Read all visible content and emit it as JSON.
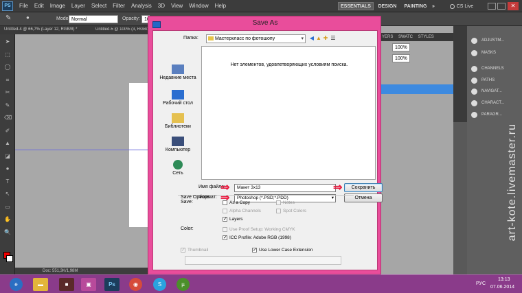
{
  "photoshop": {
    "logo": "PS",
    "menu": [
      "File",
      "Edit",
      "Image",
      "Layer",
      "Select",
      "Filter",
      "Analysis",
      "3D",
      "View",
      "Window",
      "Help"
    ],
    "workspaces": [
      "ESSENTIALS",
      "DESIGN",
      "PAINTING",
      "»"
    ],
    "cslive": "CS Live",
    "options": {
      "mode_label": "Mode:",
      "mode_value": "Normal",
      "opacity_label": "Opacity:",
      "opacity_value": "100%",
      "opacity_right": "100%",
      "fill_right": "100%"
    },
    "tabs": [
      "Untitled-4 @ 66,7% (Layer 12, RGB/8) *",
      "Untitled-5 @ 100% (3, RGB/8)*"
    ],
    "layer_panel_tabs": [
      "YERS",
      "SWATC",
      "STYLES"
    ],
    "status": "Doc: 551,3K/1,98M",
    "panels": [
      "ADJUSTM...",
      "MASKS",
      "CHANNELS",
      "PATHS",
      "NAVIGAT...",
      "CHARACT...",
      "PARAGR..."
    ]
  },
  "dialog": {
    "title": "Save As",
    "folder_label": "Папка:",
    "folder_value": "Мастеркласс по фотошопу",
    "empty_message": "Нет элементов, удовлетворяющих условиям поиска.",
    "places": [
      "Недавние места",
      "Рабочий стол",
      "Библиотеки",
      "Компьютер",
      "Сеть"
    ],
    "filename_label": "Имя файла:",
    "filename_value": "Макет 3x13",
    "format_label": "Формат:",
    "format_value": "Photoshop (*.PSD;*.PDD)",
    "save_button": "Сохранить",
    "cancel_button": "Отмена",
    "save_options": {
      "heading": "Save Options",
      "save_label": "Save:",
      "as_a_copy": "As a Copy",
      "notes": "Notes",
      "alpha_channels": "Alpha Channels",
      "spot_colors": "Spot Colors",
      "layers": "Layers",
      "color_label": "Color:",
      "use_proof_setup": "Use Proof Setup:  Working CMYK",
      "icc_profile": "ICC Profile:  Adobe RGB (1998)",
      "thumbnail": "Thumbnail",
      "lowercase_ext": "Use Lower Case Extension"
    }
  },
  "taskbar": {
    "lang": "РУС",
    "time": "13:13",
    "date": "07.06.2014"
  },
  "watermark": "art-kote.livemaster.ru",
  "colors": {
    "dialog_frame": "#e94d9b",
    "arrow": "#e8143a",
    "layer_selection": "#3d8ae0",
    "taskbar": "#8a3b8a"
  }
}
